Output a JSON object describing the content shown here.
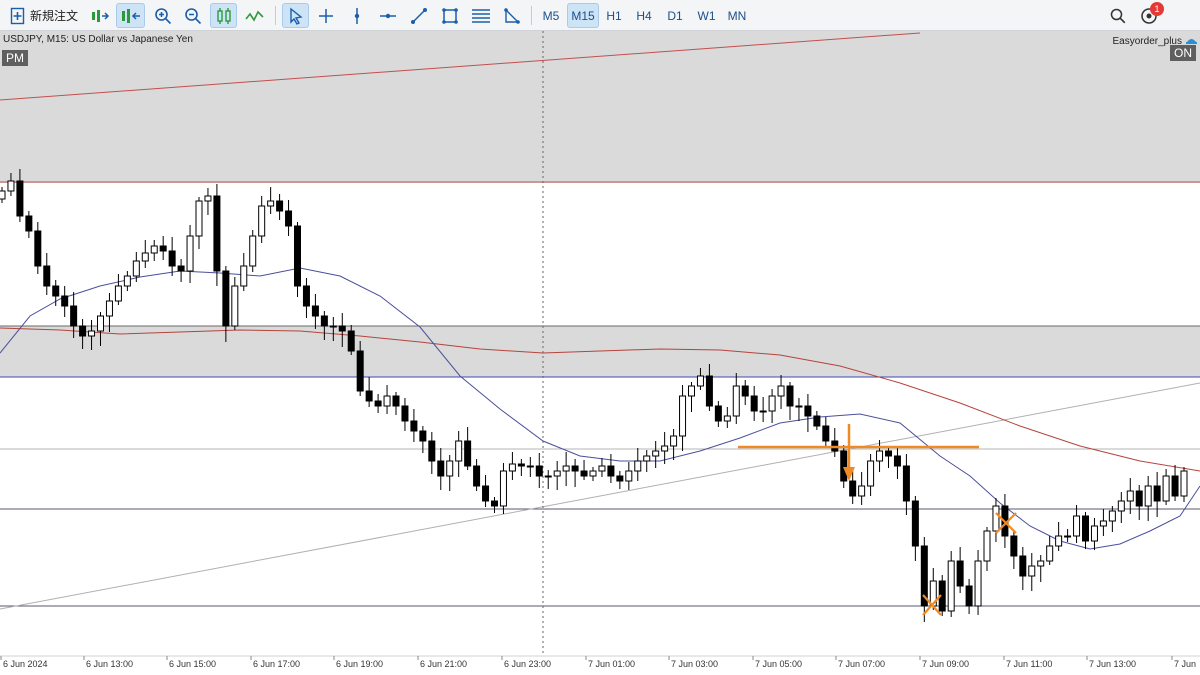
{
  "toolbar": {
    "new_order_label": "新規注文",
    "timeframes": [
      {
        "label": "M5",
        "active": false
      },
      {
        "label": "M15",
        "active": true
      },
      {
        "label": "H1",
        "active": false
      },
      {
        "label": "H4",
        "active": false
      },
      {
        "label": "D1",
        "active": false
      },
      {
        "label": "W1",
        "active": false
      },
      {
        "label": "MN",
        "active": false
      }
    ],
    "notification_count": "1",
    "icons": [
      "new-order-icon",
      "depth-of-market-icon",
      "one-click-trading-icon",
      "zoom-in-icon",
      "zoom-out-icon",
      "candlesticks-icon",
      "line-chart-icon",
      "cursor-icon",
      "crosshair-icon",
      "vertical-line-icon",
      "horizontal-line-icon",
      "trendline-icon",
      "rectangle-icon",
      "fibonacci-icon",
      "triangle-icon",
      "search-icon",
      "notifications-icon"
    ]
  },
  "chart": {
    "symbol_description": "USDJPY, M15:  US Dollar vs Japanese Yen",
    "session_badge": "PM",
    "ea_name": "Easyorder_plus",
    "ea_status": "ON",
    "time_labels": [
      "6 Jun 2024",
      "6 Jun 13:00",
      "6 Jun 15:00",
      "6 Jun 17:00",
      "6 Jun 19:00",
      "6 Jun 21:00",
      "6 Jun 23:00",
      "7 Jun 01:00",
      "7 Jun 03:00",
      "7 Jun 05:00",
      "7 Jun 07:00",
      "7 Jun 09:00",
      "7 Jun 11:00",
      "7 Jun 13:00",
      "7 Jun"
    ],
    "colors": {
      "zone_fill": "#dadada",
      "zone_upper_border": "#c0504d",
      "zone_lower_border": "#3a49b8",
      "bull_candle": "#ffffff",
      "bear_candle": "#000000",
      "ma_fast": "#4a4f9c",
      "ma_slow": "#b5443c",
      "marker": "#f08a24"
    }
  }
}
